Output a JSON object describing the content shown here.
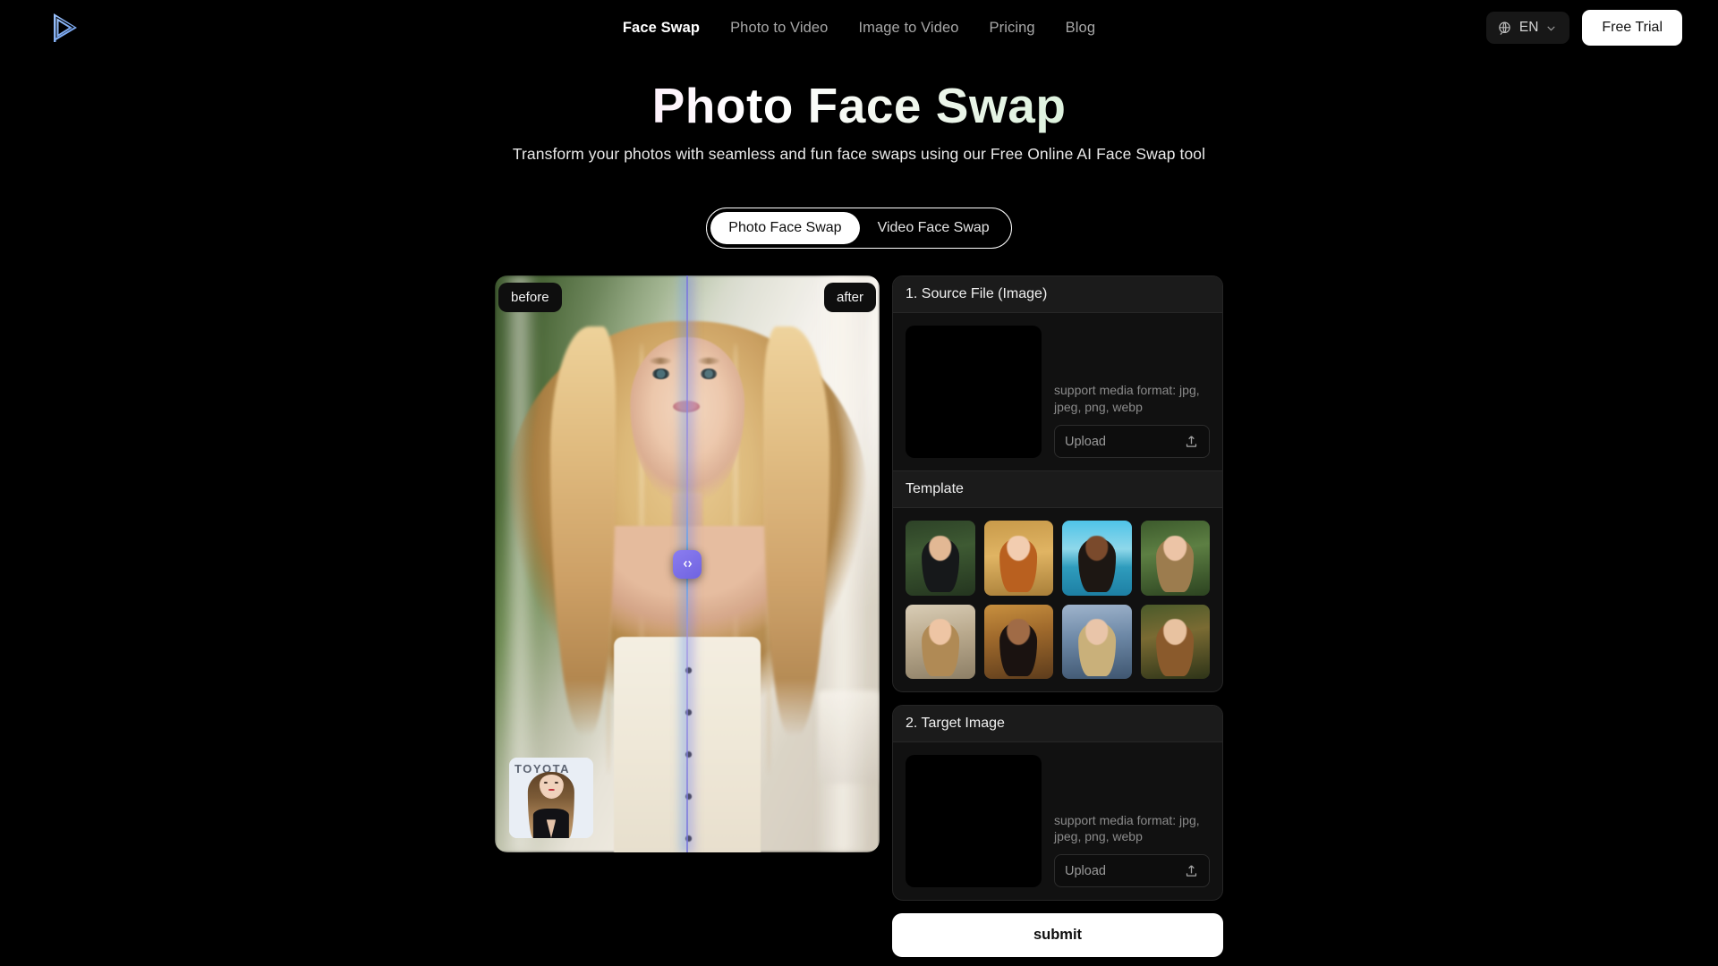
{
  "header": {
    "logo_name": "logo-play-mark",
    "nav": [
      {
        "label": "Face Swap",
        "active": true
      },
      {
        "label": "Photo to Video",
        "active": false
      },
      {
        "label": "Image to Video",
        "active": false
      },
      {
        "label": "Pricing",
        "active": false
      },
      {
        "label": "Blog",
        "active": false
      }
    ],
    "language": "EN",
    "language_icon": "globe-icon",
    "language_chevron": "chevron-down-icon",
    "free_trial_label": "Free Trial"
  },
  "hero": {
    "title": "Photo Face Swap",
    "subtitle": "Transform your photos with seamless and fun face swaps using our Free Online AI Face Swap tool",
    "title_gradient_start": "#f49ae0",
    "title_gradient_mid": "#ffffff",
    "title_gradient_end": "#9fe2ab"
  },
  "mode_toggle": {
    "options": [
      {
        "label": "Photo Face Swap",
        "active": true
      },
      {
        "label": "Video Face Swap",
        "active": false
      }
    ]
  },
  "comparison": {
    "before_label": "before",
    "after_label": "after",
    "handle_glyph": "◂|▸",
    "handle_icon": "slider-handle-icon",
    "handle_color": "#7a6ce8",
    "seam_position_percent": 50,
    "thumbnail_watermark": "TOYOTA",
    "thumbnail_name": "source-face-thumbnail"
  },
  "source_panel": {
    "title": "1. Source File (Image)",
    "support_text": "support media format: jpg, jpeg, png, webp",
    "upload_label": "Upload",
    "upload_icon": "upload-icon"
  },
  "template_panel": {
    "title": "Template",
    "items": [
      {
        "name": "template-1",
        "sky": "linear-gradient(170deg,#2d4227 0%,#3e5a33 40%,#24351f 100%)",
        "hair": "#16181a",
        "face": "#e2b894"
      },
      {
        "name": "template-2",
        "sky": "linear-gradient(175deg,#c89a4a 0%,#e0b463 45%,#a97f39 100%)",
        "hair": "#b9601f",
        "face": "#f2cdb0"
      },
      {
        "name": "template-3",
        "sky": "linear-gradient(180deg,#4fc3e8 0%,#8fd8ea 38%,#2f9cbd 62%,#1d7fa3 100%)",
        "hair": "#1d1713",
        "face": "#7a4a2c"
      },
      {
        "name": "template-4",
        "sky": "linear-gradient(170deg,#3c5a2c 0%,#5d7f43 40%,#2c4320 100%)",
        "hair": "#9c7c4e",
        "face": "#ecc4a6"
      },
      {
        "name": "template-5",
        "sky": "linear-gradient(170deg,#d9cdb6 0%,#b9a98d 45%,#8d7f66 100%)",
        "hair": "#b08a55",
        "face": "#eec5a4"
      },
      {
        "name": "template-6",
        "sky": "linear-gradient(170deg,#c8903f 0%,#a06a2c 40%,#5d3c1c 100%)",
        "hair": "#1a1210",
        "face": "#a06b46"
      },
      {
        "name": "template-7",
        "sky": "linear-gradient(175deg,#9fb4cc 0%,#6d88a6 45%,#3f5670 100%)",
        "hair": "#c9b07a",
        "face": "#e9c5a9"
      },
      {
        "name": "template-8",
        "sky": "linear-gradient(170deg,#4a5a2a 0%,#7a6b33 40%,#2e3418 100%)",
        "hair": "#8a5a2c",
        "face": "#e8c2a0"
      }
    ]
  },
  "target_panel": {
    "title": "2. Target Image",
    "support_text": "support media format: jpg, jpeg, png, webp",
    "upload_label": "Upload",
    "upload_icon": "upload-icon"
  },
  "submit": {
    "label": "submit"
  }
}
